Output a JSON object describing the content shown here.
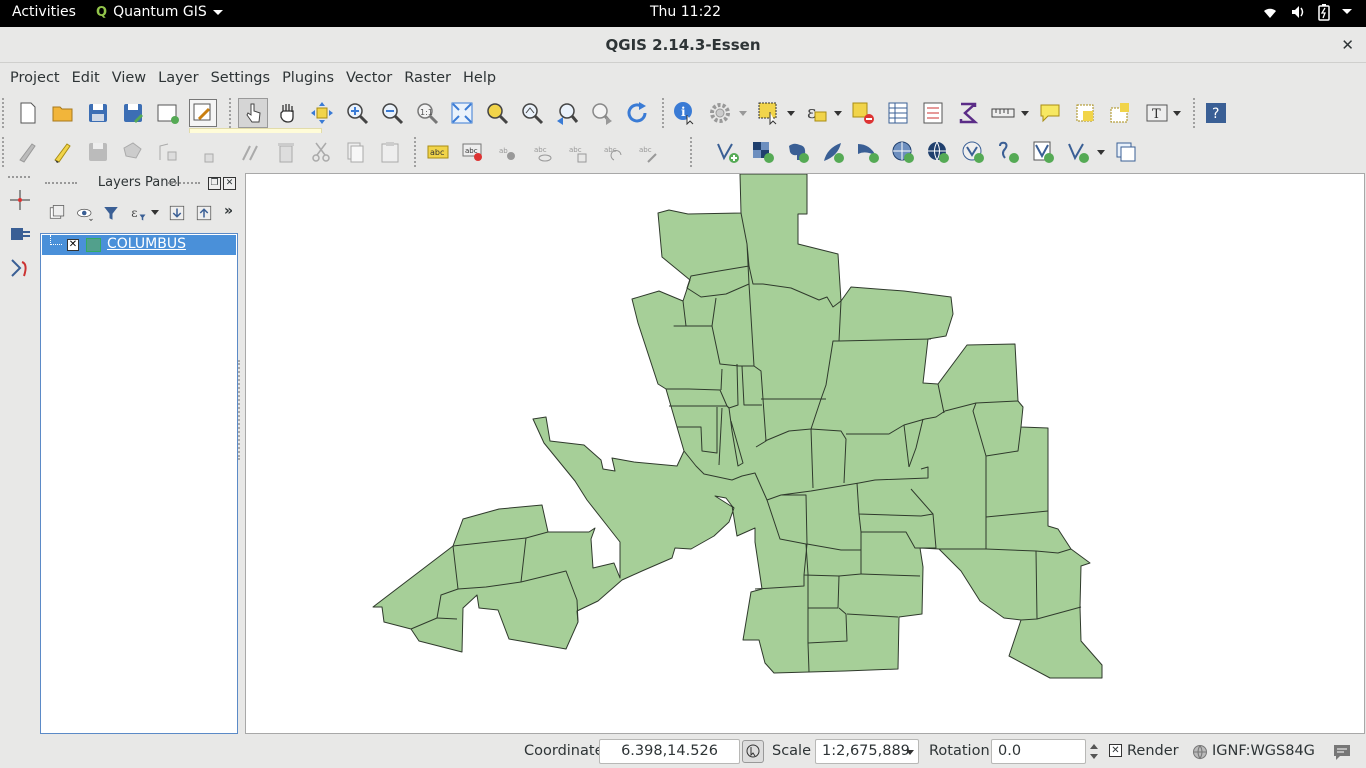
{
  "topbar": {
    "activities": "Activities",
    "app_name": "Quantum GIS",
    "clock": "Thu 11:22",
    "tray_icons": [
      "wifi-icon",
      "volume-icon",
      "battery-icon",
      "power-menu-icon"
    ]
  },
  "window": {
    "title": "QGIS 2.14.3-Essen",
    "close_glyph": "✕"
  },
  "menu": [
    "Project",
    "Edit",
    "View",
    "Layer",
    "Settings",
    "Plugins",
    "Vector",
    "Raster",
    "Help"
  ],
  "layers_panel": {
    "title": "Layers Panel",
    "more_glyph": "»",
    "layers": [
      {
        "name": "COLUMBUS",
        "checked": true,
        "symbol_color": "#52a08c"
      }
    ]
  },
  "map": {
    "fill_color": "#a6cf98",
    "stroke_color": "#2f3a2c"
  },
  "status": {
    "coordinate_label": "Coordinate",
    "coordinate_value": "6.398,14.526",
    "scale_label": "Scale",
    "scale_value": "1:2,675,889",
    "rotation_label": "Rotation",
    "rotation_value": "0.0",
    "render_label": "Render",
    "render_checked": true,
    "crs": "IGNF:WGS84G"
  },
  "colors": {
    "accent": "#4a90d9",
    "top_bar": "#000000",
    "chrome": "#e8e8e7"
  }
}
